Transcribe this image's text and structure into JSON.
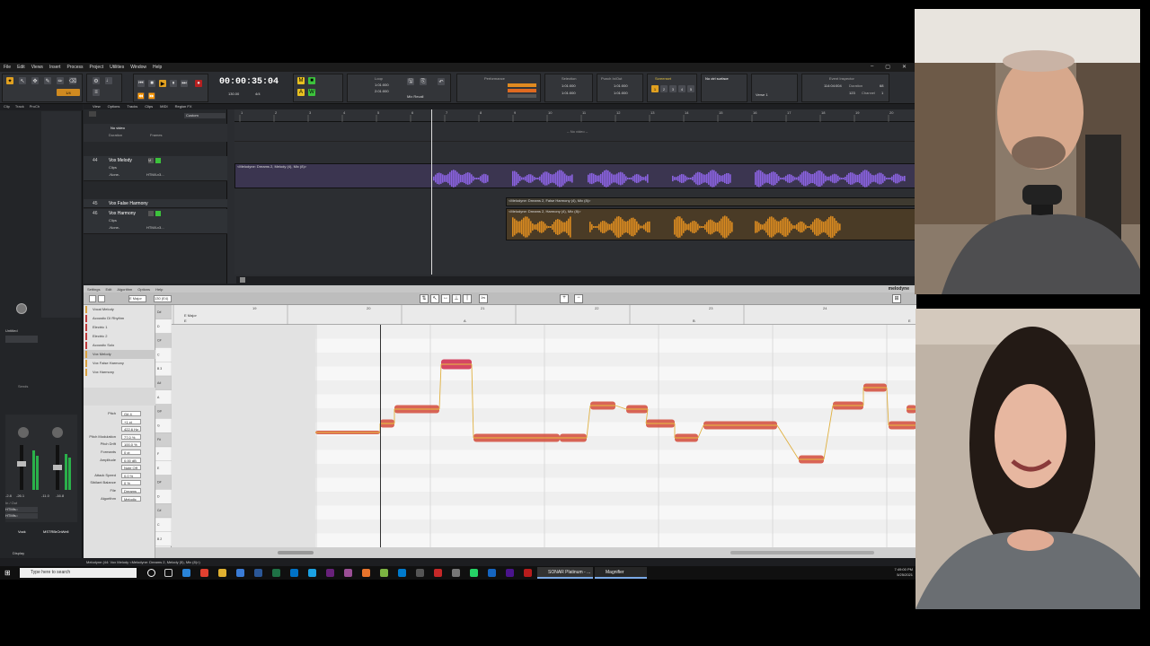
{
  "menu": [
    "File",
    "Edit",
    "Views",
    "Insert",
    "Process",
    "Project",
    "Utilities",
    "Window",
    "Help"
  ],
  "transport": {
    "time": "00:00:35:04",
    "tempo": "130.00",
    "meter": "4/4",
    "loop_label": "Loop",
    "loop_start": "1:01:000",
    "loop_end": "2:01:000",
    "mix_recall": "Mix Recall",
    "performance_label": "Performance",
    "selection_label": "Selection",
    "selection_start": "1:01:000",
    "selection_end": "1:01:000",
    "punch_label": "Punch In/Out",
    "punch_start": "1:01:000",
    "punch_end": "1:01:000",
    "screenset_label": "Screenset",
    "control_surface": "No ctrl surface",
    "verse": "Verse 1",
    "event_label": "Event Inspector",
    "event_time": "114:04:004",
    "duration_label": "Duration",
    "event_val1": "68",
    "event_val2": "123",
    "channel_label": "Channel",
    "channel_val": "1"
  },
  "inspector": {
    "tabs": [
      "Clip",
      "Track",
      "ProCh"
    ],
    "label_untitled": "Untitled",
    "sends_label": "Sends",
    "in_out": "In / Out",
    "input": "HTMfs::",
    "output": "HTMfs::",
    "vol_left": "-2.8",
    "vol_right": "-26.1",
    "vol_left2": "-11.0",
    "vol_right2": "-16.8",
    "track_name_left": "Vock",
    "track_name_right": "MSTRBrOnWell",
    "bottom_label": "Display"
  },
  "trackview": {
    "menu": [
      "View",
      "Options",
      "Tracks",
      "Clips",
      "MIDI",
      "Region FX"
    ],
    "custom": "Custom",
    "no_video": "No video",
    "duration": "Duration",
    "frames": "Frames",
    "video_placeholder": "-- No video --",
    "tracks": [
      {
        "num": "44",
        "name": "Vox Melody",
        "sub": "Clips",
        "input": "-None-",
        "output": "HTM/Lv3..."
      },
      {
        "num": "45",
        "name": "Vox False Harmony",
        "sub": "",
        "input": "",
        "output": ""
      },
      {
        "num": "46",
        "name": "Vox Harmony",
        "sub": "Clips",
        "input": "-None-",
        "output": "HTM/Lv3..."
      }
    ],
    "clip_melody": "<Melodyne: Dreams 2, Melody (4), Mix (8)>",
    "clip_false": "<Melodyne: Dreams 2, False Harmony (4), Mix (8)>",
    "clip_harmony": "<Melodyne: Dreams 2, Harmony (4), Mix (8)>",
    "ruler_marks": [
      "1",
      "2",
      "3",
      "4",
      "5",
      "6",
      "7",
      "8",
      "9",
      "10",
      "11",
      "12",
      "13",
      "14",
      "15",
      "16",
      "17",
      "18",
      "19",
      "20"
    ]
  },
  "melodyne": {
    "menu": [
      "Settings",
      "Edit",
      "Algorithm",
      "Options",
      "Help"
    ],
    "key": "E Major",
    "tempo": "130 (E4)",
    "logo": "melodyne",
    "tracks": [
      {
        "name": "Vocal Melody",
        "color": "#d9a040"
      },
      {
        "name": "Acoustic DI Rhythm",
        "color": "#c03a3a"
      },
      {
        "name": "Electric 1",
        "color": "#c03a3a"
      },
      {
        "name": "Electric 2",
        "color": "#c03a3a"
      },
      {
        "name": "Acoustic Solo",
        "color": "#c03a3a"
      },
      {
        "name": "Vox Melody",
        "color": "#d9a040"
      },
      {
        "name": "Vox False Harmony",
        "color": "#d9a040"
      },
      {
        "name": "Vox Harmony",
        "color": "#d9a040"
      }
    ],
    "params": [
      {
        "label": "Pitch",
        "value": "G# 4"
      },
      {
        "label": "",
        "value": "+1 ct"
      },
      {
        "label": "",
        "value": "422.6 Hz"
      },
      {
        "label": "Pitch Modulation",
        "value": "77.0 %"
      },
      {
        "label": "Pitch Drift",
        "value": "100.0 %"
      },
      {
        "label": "Formants",
        "value": "0 ct"
      },
      {
        "label": "Amplitude",
        "value": "0.00 dB"
      },
      {
        "label": "",
        "value": "Note Off"
      },
      {
        "label": "Attack Speed",
        "value": "0.0 %"
      },
      {
        "label": "Sibilant Balance",
        "value": "0 %"
      },
      {
        "label": "File",
        "value": "Dreams ...s (8)"
      },
      {
        "label": "Algorithm",
        "value": "Melodic"
      }
    ],
    "bars": [
      "19",
      "20",
      "21",
      "22",
      "23",
      "24"
    ],
    "section_key": "E Major",
    "chord_e": "E",
    "chord_a": "A",
    "chord_b": "B",
    "chord_e2": "E",
    "keys": [
      "D#",
      "D",
      "C#",
      "C",
      "B 3",
      "A#",
      "A",
      "G#",
      "G",
      "F#",
      "F",
      "E",
      "D#",
      "D",
      "C#",
      "C",
      "B 2"
    ]
  },
  "status": "Melodyne (44: Vox Melody <Melodyne: Dreams 2, Melody (5), Mix (8)>)",
  "taskbar": {
    "search": "Type here to search",
    "app1": "SONAR Platinum - ...",
    "app2": "Magnifier",
    "time": "7:49:00 PM",
    "date": "5/25/2021"
  }
}
